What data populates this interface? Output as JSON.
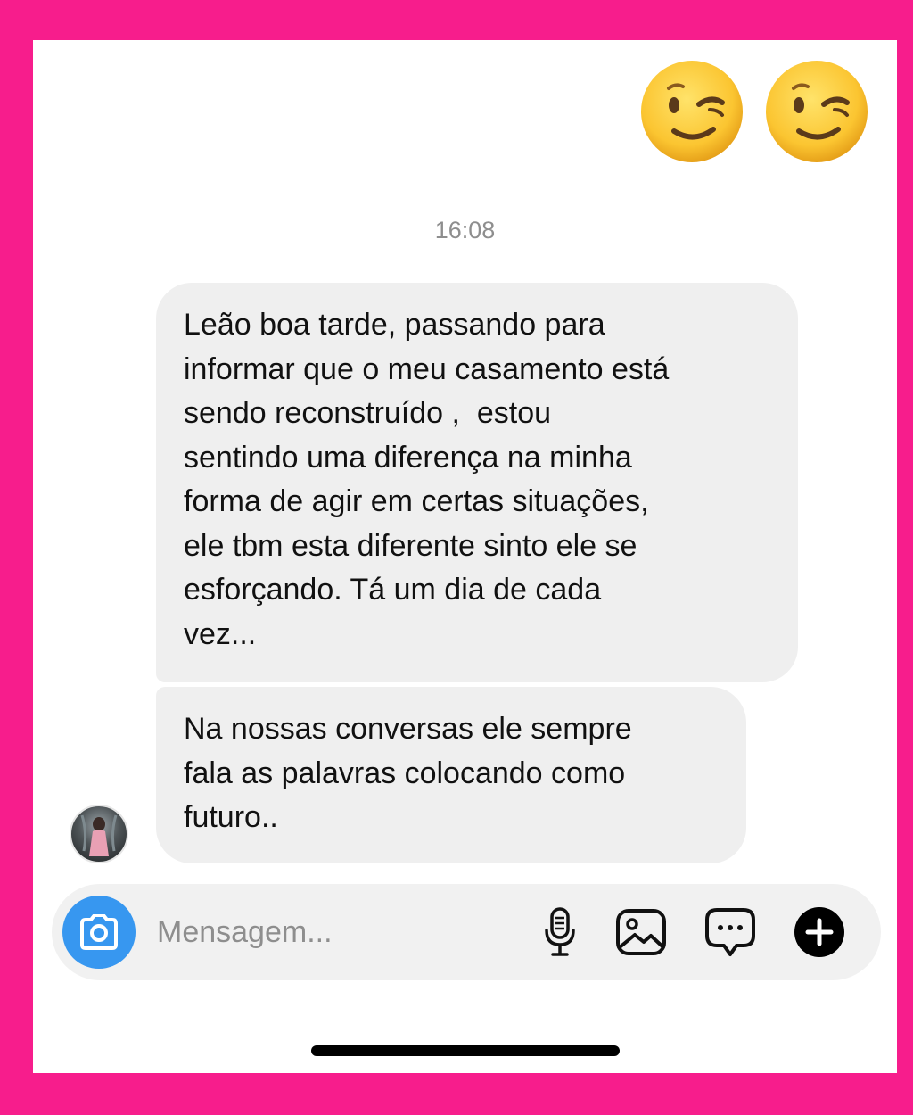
{
  "chat": {
    "reactions": [
      "😉",
      "😉"
    ],
    "timestamp": "16:08",
    "messages": [
      {
        "lines": [
          "Leão boa tarde, passando para",
          "informar que o meu casamento está",
          "sendo reconstruído ,  estou",
          "sentindo uma diferença na minha",
          "forma de agir em certas situações,",
          "ele tbm esta diferente sinto ele se",
          "esforçando. Tá um dia de cada",
          "vez..."
        ]
      },
      {
        "lines": [
          "Na nossas conversas ele sempre",
          "fala as palavras colocando como",
          "futuro.."
        ]
      }
    ]
  },
  "composer": {
    "placeholder": "Mensagem...",
    "icons": {
      "camera": "camera-icon",
      "mic": "microphone-icon",
      "gallery": "image-icon",
      "sticker": "chat-bubble-icon",
      "plus": "plus-icon"
    }
  },
  "colors": {
    "frame": "#f71d8c",
    "bubble": "#efefef",
    "camera_button": "#3797f0",
    "placeholder": "#8e8e8e"
  }
}
